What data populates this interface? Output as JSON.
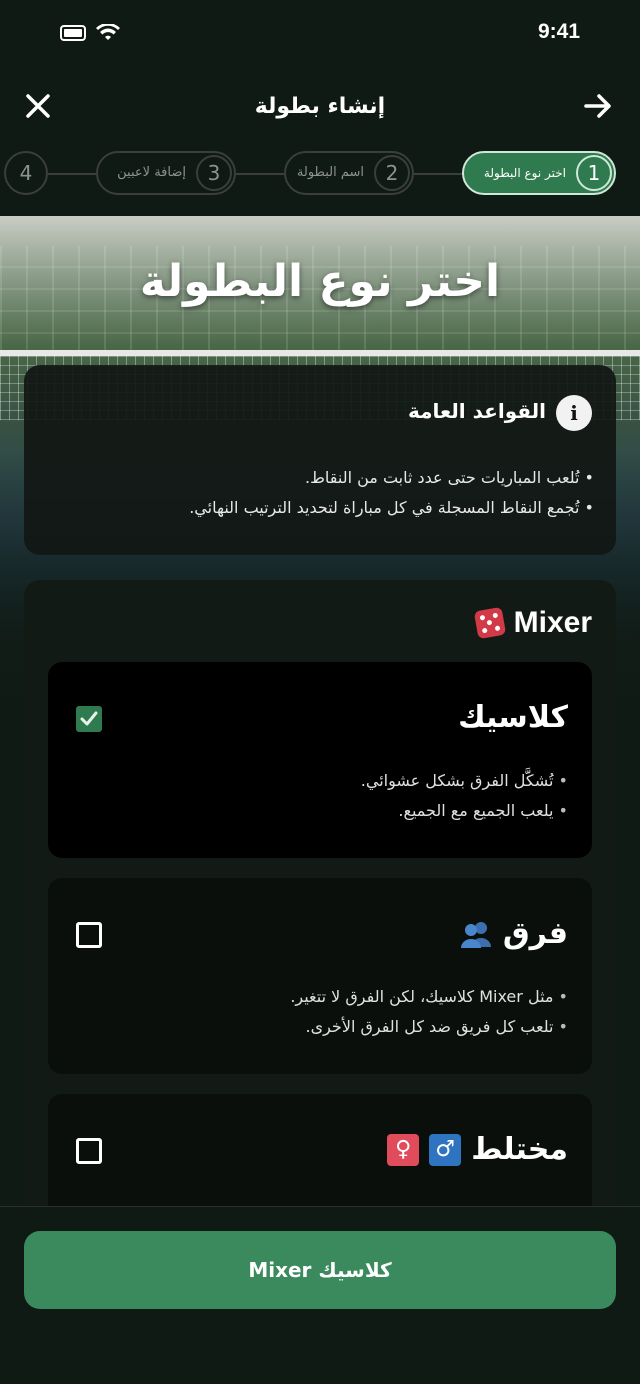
{
  "status_bar": {
    "time": "9:41"
  },
  "nav": {
    "title": "إنشاء بطولة"
  },
  "stepper": {
    "steps": [
      {
        "number": "1",
        "label": "اختر نوع البطولة"
      },
      {
        "number": "2",
        "label": "اسم البطولة"
      },
      {
        "number": "3",
        "label": "إضافة لاعبين"
      },
      {
        "number": "4",
        "label": ""
      }
    ]
  },
  "hero": {
    "title": "اختر نوع البطولة"
  },
  "rules": {
    "title": "القواعد العامة",
    "bullets": [
      "تُلعب المباريات حتى عدد ثابت من النقاط.",
      "تُجمع النقاط المسجلة في كل مباراة لتحديد الترتيب النهائي."
    ]
  },
  "mixer": {
    "title": "Mixer",
    "options": [
      {
        "title": "كلاسيك",
        "checked": true,
        "bullets": [
          "تُشكَّل الفرق بشكل عشوائي.",
          "يلعب الجميع مع الجميع."
        ]
      },
      {
        "title": "فرق",
        "checked": false,
        "bullets": [
          "مثل Mixer كلاسيك، لكن الفرق لا تتغير.",
          "تلعب كل فريق ضد كل الفرق الأخرى."
        ]
      },
      {
        "title": "مختلط",
        "checked": false,
        "male_symbol": "♂",
        "female_symbol": "♀"
      }
    ]
  },
  "cta": {
    "label": "Mixer كلاسيك"
  },
  "colors": {
    "accent": "#3a8a5e",
    "background": "#101a14"
  }
}
